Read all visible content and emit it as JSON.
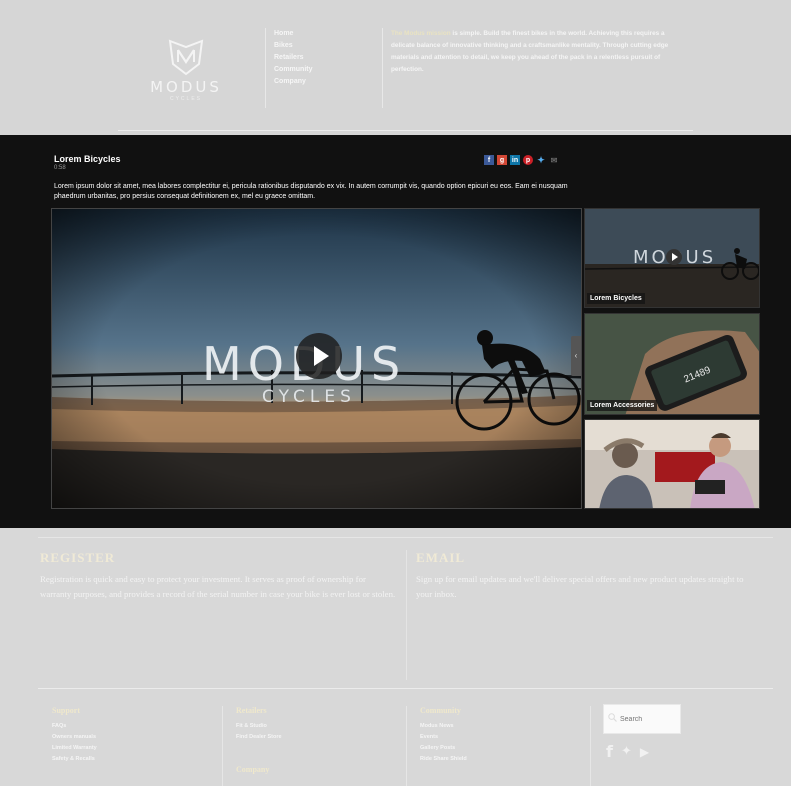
{
  "header": {
    "logo_word": "MODUS",
    "logo_sub": "CYCLES",
    "nav": [
      "Home",
      "Bikes",
      "Retailers",
      "Community",
      "Company"
    ],
    "intro_accent": "The Modus mission",
    "intro_text": " is simple. Build the finest bikes in the world. Achieving this requires a delicate balance of innovative thinking and a craftsmanlike mentality. Through cutting edge materials and attention to detail, we keep you ahead of the pack in a relentless pursuit of perfection."
  },
  "video": {
    "title": "Lorem Bicycles",
    "time": "0:58",
    "description": "Lorem ipsum dolor sit amet, mea labores complectitur ei, pericula rationibus disputando ex vix. In autem corrumpit vis, quando option epicuri eu eos. Eam ei nusquam phaedrum urbanitas, pro persius consequat definitionem ex, mel eu graece omittam.",
    "player_logo": "MODUS",
    "player_sub": "CYCLES",
    "share_icons": [
      "facebook-icon",
      "google-plus-icon",
      "linkedin-icon",
      "pinterest-icon",
      "twitter-icon",
      "email-icon"
    ],
    "thumbnails": [
      {
        "caption": "Lorem Bicycles",
        "logo": "MODUS"
      },
      {
        "caption": "Lorem Accessories",
        "speed": "21489"
      },
      {
        "caption": ""
      }
    ]
  },
  "register": {
    "title": "REGISTER",
    "body": "Registration is quick and easy to protect your investment. It serves as proof of ownership for warranty purposes, and provides a record of the serial number in case your bike is ever lost or stolen."
  },
  "email": {
    "title": "EMAIL",
    "body": "Sign up for email updates and we'll deliver special offers and new product updates straight to your inbox."
  },
  "footer": {
    "support": {
      "title": "Support",
      "links": [
        "FAQs",
        "Owners manuals",
        "Limited Warranty",
        "Safety & Recalls"
      ]
    },
    "retailers": {
      "title": "Retailers",
      "links": [
        "Fit & Studio",
        "Find Dealer Store"
      ],
      "second_title": "Company"
    },
    "community": {
      "title": "Community",
      "links": [
        "Modus News",
        "Events",
        "Gallery Posts",
        "Ride Share Shield"
      ]
    },
    "search_placeholder": "Search",
    "social_icons": [
      "facebook-icon",
      "twitter-icon",
      "youtube-icon"
    ]
  },
  "colors": {
    "band": "#111111",
    "page": "#d8d8d8",
    "accent": "#e9e3c2"
  }
}
